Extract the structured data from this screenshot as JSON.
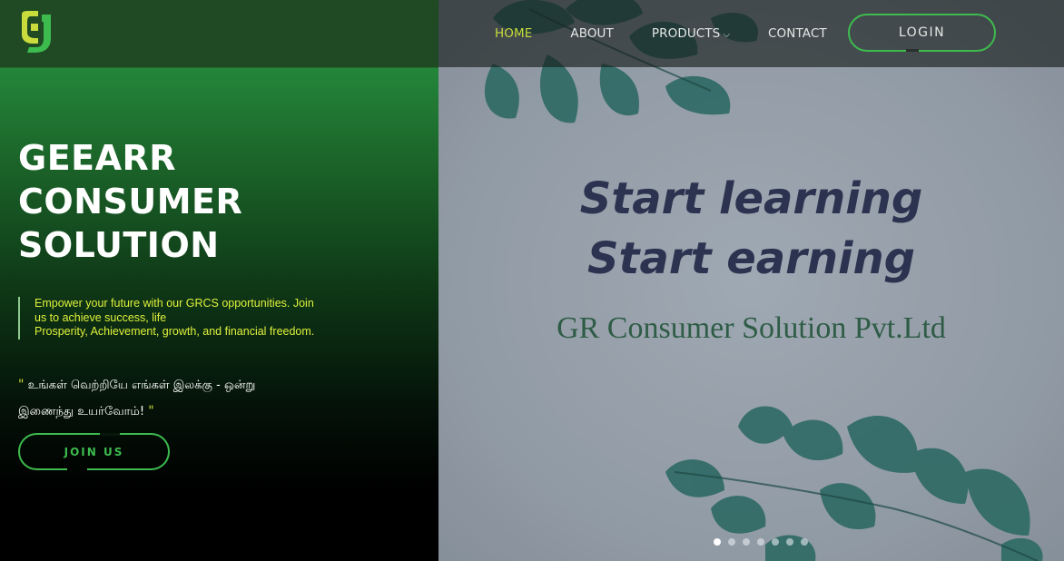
{
  "brand": {
    "logo_icon": "gr-logo-icon",
    "accent_green": "#3dbb4e",
    "accent_yellow": "#c9dc3c"
  },
  "nav": {
    "items": [
      {
        "label": "HOME",
        "active": true
      },
      {
        "label": "ABOUT",
        "active": false
      },
      {
        "label": "PRODUCTS",
        "active": false,
        "icon": "chevron-down-icon"
      },
      {
        "label": "CONTACT",
        "active": false
      }
    ],
    "login_label": "LOGIN"
  },
  "hero": {
    "title_lines": [
      "GEEARR",
      "CONSUMER",
      "SOLUTION"
    ],
    "tagline_line1": "Empower your future with our GRCS opportunities. Join",
    "tagline_line2": "us to achieve success, life",
    "tagline_line3": "Prosperity, Achievement, growth, and financial freedom.",
    "quote_line1": "உங்கள் வெற்றியே எங்கள் இலக்கு - ஒன்று",
    "quote_line2": "இணைந்து உயர்வோம்!",
    "quote_open": "\"",
    "quote_close": "\"",
    "join_label": "JOIN US"
  },
  "slider": {
    "heading_line1": "Start learning",
    "heading_line2": "Start earning",
    "company": "GR Consumer Solution Pvt.Ltd",
    "slide_count": 7,
    "active_index": 0
  }
}
